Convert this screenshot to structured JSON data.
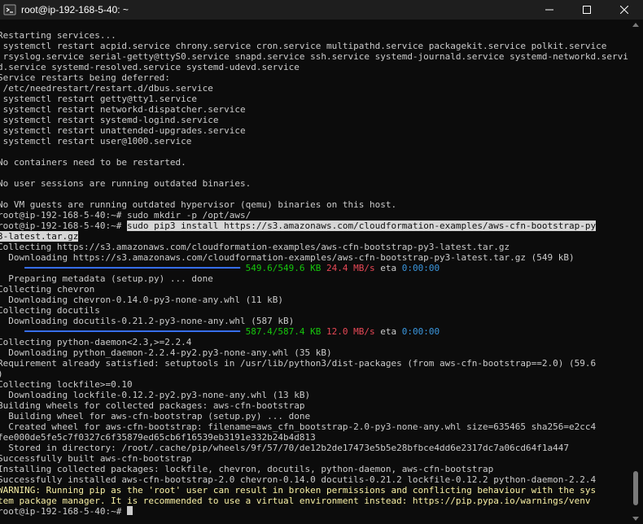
{
  "window": {
    "title": "root@ip-192-168-5-40: ~",
    "icon": "terminal-icon",
    "controls": [
      "minimize-icon",
      "maximize-icon",
      "close-icon"
    ]
  },
  "terminal": {
    "lines": [
      {
        "t": "Restarting services..."
      },
      {
        "t": " systemctl restart acpid.service chrony.service cron.service multipathd.service packagekit.service polkit.service"
      },
      {
        "t": " rsyslog.service serial-getty@ttyS0.service snapd.service ssh.service systemd-journald.service systemd-networkd.service"
      },
      {
        "t": "d.service systemd-resolved.service systemd-udevd.service"
      },
      {
        "t": "Service restarts being deferred:"
      },
      {
        "t": " /etc/needrestart/restart.d/dbus.service"
      },
      {
        "t": " systemctl restart getty@tty1.service"
      },
      {
        "t": " systemctl restart networkd-dispatcher.service"
      },
      {
        "t": " systemctl restart systemd-logind.service"
      },
      {
        "t": " systemctl restart unattended-upgrades.service"
      },
      {
        "t": " systemctl restart user@1000.service"
      },
      {
        "t": ""
      },
      {
        "t": "No containers need to be restarted."
      },
      {
        "t": ""
      },
      {
        "t": "No user sessions are running outdated binaries."
      },
      {
        "t": ""
      },
      {
        "t": "No VM guests are running outdated hypervisor (qemu) binaries on this host."
      },
      {
        "t": "root@ip-192-168-5-40:~# sudo mkdir -p /opt/aws/"
      },
      {
        "k": "sel",
        "p": "root@ip-192-168-5-40:~# ",
        "s": "sudo pip3 install https://s3.amazonaws.com/cloudformation-examples/aws-cfn-bootstrap-py"
      },
      {
        "k": "selall",
        "s": "3-latest.tar.gz"
      },
      {
        "t": "Collecting https://s3.amazonaws.com/cloudformation-examples/aws-cfn-bootstrap-py3-latest.tar.gz"
      },
      {
        "t": "  Downloading https://s3.amazonaws.com/cloudformation-examples/aws-cfn-bootstrap-py3-latest.tar.gz (549 kB)"
      },
      {
        "k": "prog",
        "bar": "     ━━━━━━━━━━━━━━━━━━━━━━━━━━━━━━━━━━━━━━━━ ",
        "size": "549.6/549.6 KB",
        "speed": "24.4 MB/s",
        "eta_label": "eta",
        "eta": "0:00:00"
      },
      {
        "t": "  Preparing metadata (setup.py) ... done"
      },
      {
        "t": "Collecting chevron"
      },
      {
        "t": "  Downloading chevron-0.14.0-py3-none-any.whl (11 kB)"
      },
      {
        "t": "Collecting docutils"
      },
      {
        "t": "  Downloading docutils-0.21.2-py3-none-any.whl (587 kB)"
      },
      {
        "k": "prog",
        "bar": "     ━━━━━━━━━━━━━━━━━━━━━━━━━━━━━━━━━━━━━━━━ ",
        "size": "587.4/587.4 KB",
        "speed": "12.0 MB/s",
        "eta_label": "eta",
        "eta": "0:00:00"
      },
      {
        "t": "Collecting python-daemon<2.3,>=2.2.4"
      },
      {
        "t": "  Downloading python_daemon-2.2.4-py2.py3-none-any.whl (35 kB)"
      },
      {
        "t": "Requirement already satisfied: setuptools in /usr/lib/python3/dist-packages (from aws-cfn-bootstrap==2.0) (59.6"
      },
      {
        "t": ")"
      },
      {
        "t": "Collecting lockfile>=0.10"
      },
      {
        "t": "  Downloading lockfile-0.12.2-py2.py3-none-any.whl (13 kB)"
      },
      {
        "t": "Building wheels for collected packages: aws-cfn-bootstrap"
      },
      {
        "t": "  Building wheel for aws-cfn-bootstrap (setup.py) ... done"
      },
      {
        "t": "  Created wheel for aws-cfn-bootstrap: filename=aws_cfn_bootstrap-2.0-py3-none-any.whl size=635465 sha256=e2cc4"
      },
      {
        "t": "fee000de5fe5c7f0327c6f35879ed65cb6f16539eb3191e332b24b4d813"
      },
      {
        "t": "  Stored in directory: /root/.cache/pip/wheels/9f/57/70/de12b2de17473e5b5e28bfbce4dd6e2317dc7a06cd64f1a447"
      },
      {
        "t": "Successfully built aws-cfn-bootstrap"
      },
      {
        "t": "Installing collected packages: lockfile, chevron, docutils, python-daemon, aws-cfn-bootstrap"
      },
      {
        "t": "Successfully installed aws-cfn-bootstrap-2.0 chevron-0.14.0 docutils-0.21.2 lockfile-0.12.2 python-daemon-2.2.4"
      },
      {
        "k": "warn",
        "t": "WARNING: Running pip as the 'root' user can result in broken permissions and conflicting behaviour with the sys"
      },
      {
        "k": "warn",
        "t": "tem package manager. It is recommended to use a virtual environment instead: https://pip.pypa.io/warnings/venv"
      },
      {
        "k": "prompt",
        "t": "root@ip-192-168-5-40:~# "
      }
    ]
  },
  "colors": {
    "background": "#0c0c0c",
    "foreground": "#cccccc",
    "selection": "#d6d6d6",
    "progress_bar": "#3b78ff",
    "progress_size": "#16c60c",
    "progress_speed": "#e74856",
    "progress_eta": "#3a96dd",
    "warning": "#f9f1a5"
  }
}
